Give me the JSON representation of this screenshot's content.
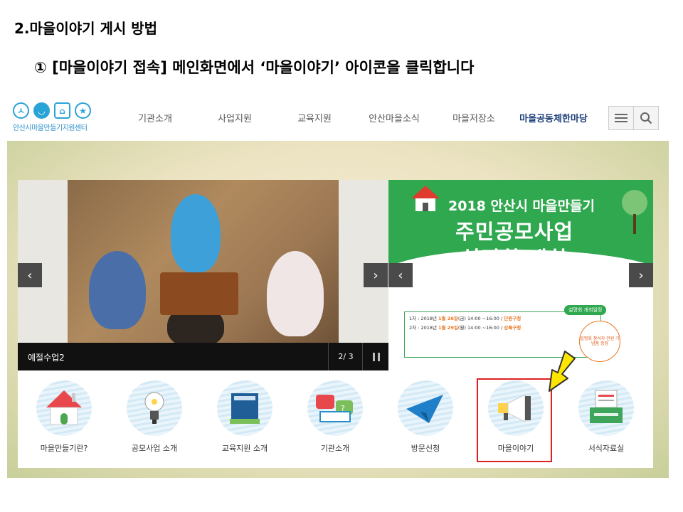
{
  "slide": {
    "title": "2.마을이야기 게시 방법",
    "subtitle": "① [마을이야기 접속] 메인화면에서 ‘마을이야기’ 아이콘을 클릭합니다"
  },
  "site": {
    "logo_text": "안산시마을만들기지원센터",
    "nav": [
      "기관소개",
      "사업지원",
      "교육지원",
      "안산마을소식",
      "마을저장소",
      "마을공동체한마당"
    ],
    "menu_icon": "hamburger-icon",
    "search_icon": "search-icon",
    "accent_color": "#2aa3d6"
  },
  "slider_left": {
    "caption": "예절수업2",
    "pager": "2/ 3"
  },
  "banner": {
    "line1": "2018 안산시 마을만들기",
    "line2": "주민공모사업",
    "line3": "설명회 개최",
    "tag": "설명회 개최일정",
    "info_lines": [
      {
        "prefix": "1차 : 2018년 ",
        "date": "1월 26일",
        "mid": "(금) 14:00 ~16:00 / ",
        "place": "단원구청"
      },
      {
        "prefix": "2차 : 2018년 ",
        "date": "1월 29일",
        "mid": "(월) 14:00 ~16:00 / ",
        "place": "상록구청"
      }
    ],
    "circle_text": "설명회 참석자 전원 기념품 증정"
  },
  "icons": [
    {
      "name": "village-house-icon",
      "label": "마을만들기란?"
    },
    {
      "name": "lightbulb-icon",
      "label": "공모사업 소개"
    },
    {
      "name": "book-icon",
      "label": "교육지원 소개"
    },
    {
      "name": "chat-bubble-icon",
      "label": "기관소개"
    },
    {
      "name": "paper-plane-icon",
      "label": "방문신청"
    },
    {
      "name": "megaphone-icon",
      "label": "마을이야기"
    },
    {
      "name": "printer-document-icon",
      "label": "서식자료실"
    }
  ]
}
